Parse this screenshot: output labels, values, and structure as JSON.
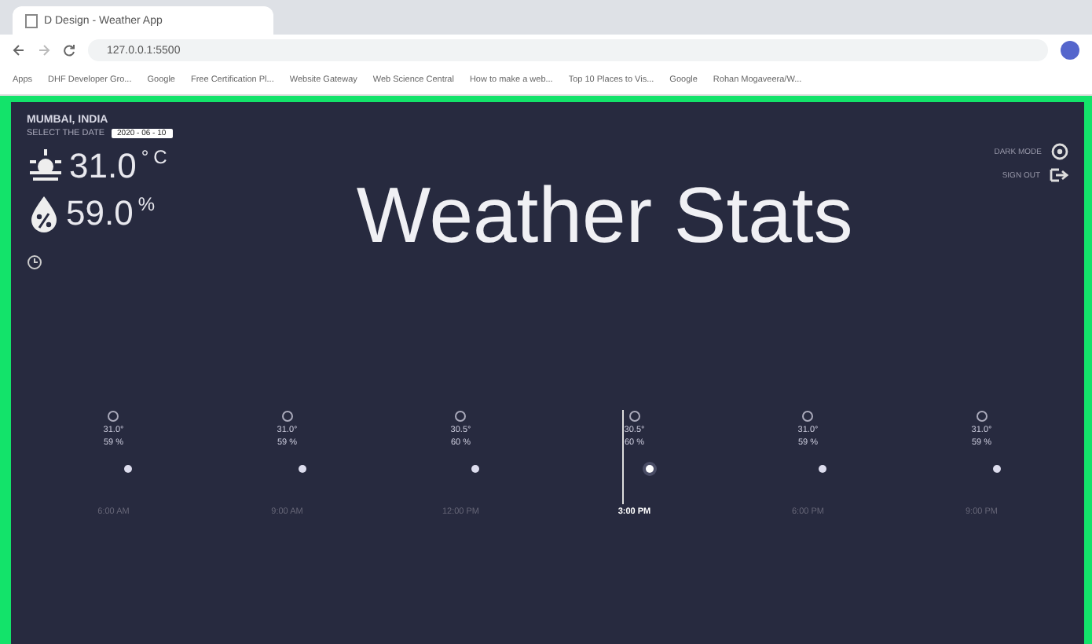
{
  "browser": {
    "tab_title": "D Design - Weather App",
    "address": "127.0.0.1:5500",
    "bookmarks": [
      "Apps",
      "DHF Developer Gro...",
      "Google",
      "Free Certification Pl...",
      "Website Gateway",
      "Web Science Central",
      "How to make a web...",
      "Top 10 Places to Vis...",
      "Google",
      "Rohan Mogaveera/W..."
    ]
  },
  "location": "MUMBAI, INDIA",
  "date_label": "SELECT THE DATE",
  "date_value": "2020 - 06 - 10",
  "temperature": {
    "value": "31.0",
    "degree": "°",
    "unit": "C"
  },
  "humidity": {
    "value": "59.0",
    "unit": "%"
  },
  "title": "Weather Stats",
  "actions": [
    {
      "label": "DARK MODE"
    },
    {
      "label": "SIGN OUT"
    }
  ],
  "timeline": [
    {
      "temp": "31.0°",
      "humidity": "59 %",
      "time": "6:00 AM",
      "selected": false
    },
    {
      "temp": "31.0°",
      "humidity": "59 %",
      "time": "9:00 AM",
      "selected": false
    },
    {
      "temp": "30.5°",
      "humidity": "60 %",
      "time": "12:00 PM",
      "selected": false
    },
    {
      "temp": "30.5°",
      "humidity": "60 %",
      "time": "3:00 PM",
      "selected": true
    },
    {
      "temp": "31.0°",
      "humidity": "59 %",
      "time": "6:00 PM",
      "selected": false
    },
    {
      "temp": "31.0°",
      "humidity": "59 %",
      "time": "9:00 PM",
      "selected": false
    }
  ]
}
